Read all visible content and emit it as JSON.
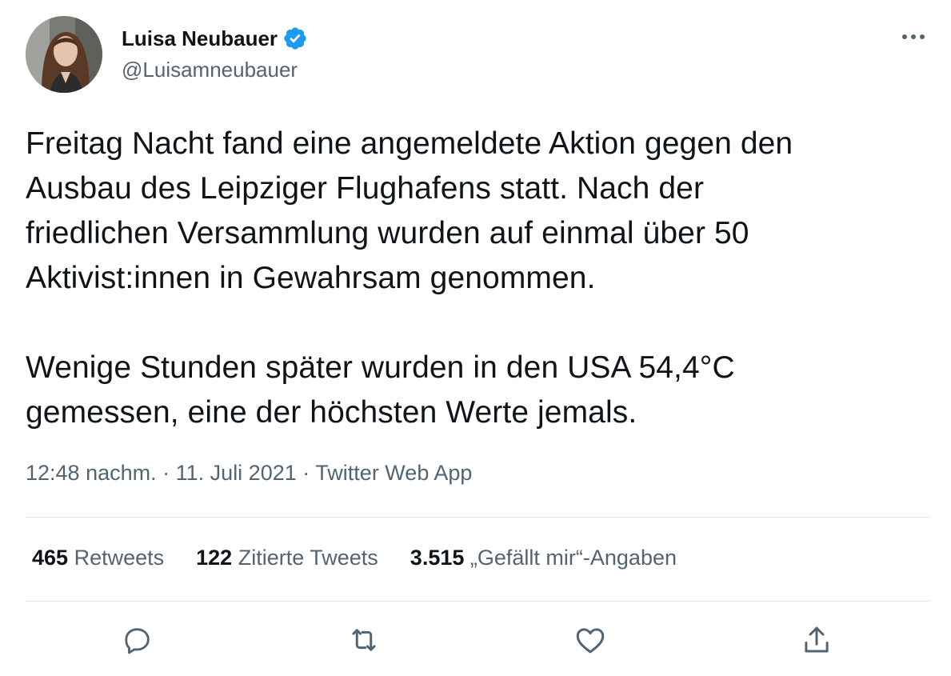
{
  "author": {
    "display_name": "Luisa Neubauer",
    "handle": "@Luisamneubauer",
    "verified": true
  },
  "tweet": {
    "text": "Freitag Nacht fand eine angemeldete Aktion gegen den\nAusbau des Leipziger Flughafens statt. Nach der\nfriedlichen Versammlung wurden auf einmal über 50\nAktivist:innen in Gewahrsam genommen.\n\nWenige Stunden später wurden in den USA 54,4°C\ngemessen, eine der höchsten Werte jemals.",
    "time": "12:48 nachm.",
    "separator": "·",
    "date": "11. Juli 2021",
    "source": "Twitter Web App"
  },
  "stats": {
    "retweets_count": "465",
    "retweets_label": "Retweets",
    "quotes_count": "122",
    "quotes_label": "Zitierte Tweets",
    "likes_count": "3.515",
    "likes_label": "„Gefällt mir“-Angaben"
  },
  "icons": {
    "more": "more-icon",
    "reply": "reply-icon",
    "retweet": "retweet-icon",
    "like": "heart-icon",
    "share": "share-icon",
    "verified": "verified-badge-icon"
  },
  "colors": {
    "text": "#0f1419",
    "secondary": "#536471",
    "verified": "#1d9bf0",
    "divider": "#e1e8ed"
  }
}
